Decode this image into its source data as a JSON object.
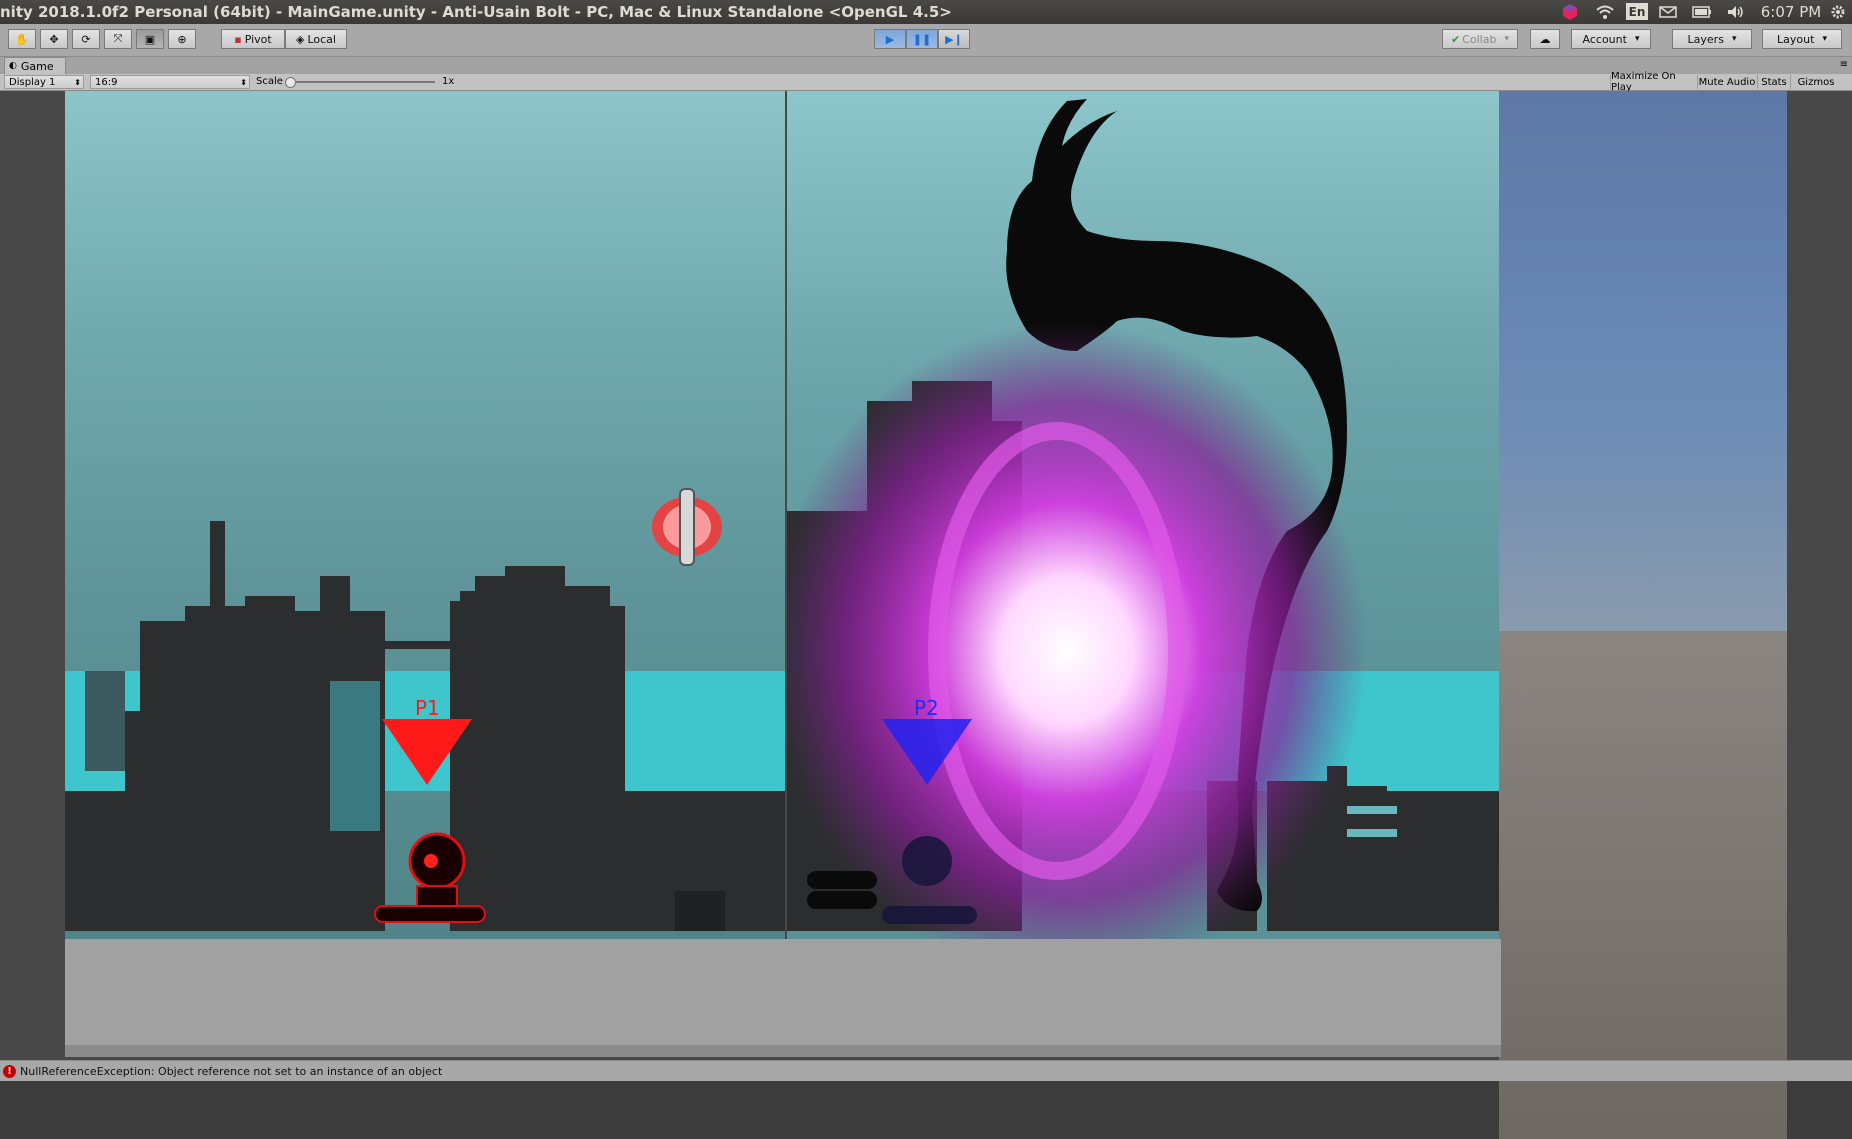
{
  "window": {
    "title": "nity 2018.1.0f2 Personal (64bit) - MainGame.unity - Anti-Usain Bolt - PC, Mac & Linux Standalone <OpenGL 4.5>"
  },
  "tray": {
    "language": "En",
    "clock": "6:07 PM",
    "icons": [
      "unity-hub-icon",
      "wifi-icon",
      "mail-icon",
      "battery-icon",
      "volume-icon",
      "settings-gear-icon"
    ]
  },
  "toolbar": {
    "tools": [
      "hand-tool-icon",
      "move-tool-icon",
      "rotate-tool-icon",
      "scale-tool-icon",
      "rect-tool-icon",
      "transform-tool-icon"
    ],
    "pivot_label": "Pivot",
    "local_label": "Local",
    "collab_label": "Collab",
    "account_label": "Account",
    "layers_label": "Layers",
    "layout_label": "Layout"
  },
  "game_panel": {
    "tab_label": "Game",
    "display_label": "Display 1",
    "aspect_label": "16:9",
    "scale_label": "Scale",
    "scale_value_label": "1x",
    "maximize_label": "Maximize On Play",
    "mute_label": "Mute Audio",
    "stats_label": "Stats",
    "gizmos_label": "Gizmos"
  },
  "scene": {
    "player1_label": "P1",
    "player2_label": "P2",
    "player1_color": "#ff1a1a",
    "player2_color": "#2222ee",
    "portal_color": "#d23ce0"
  },
  "status": {
    "message": "NullReferenceException: Object reference not set to an instance of an object"
  }
}
